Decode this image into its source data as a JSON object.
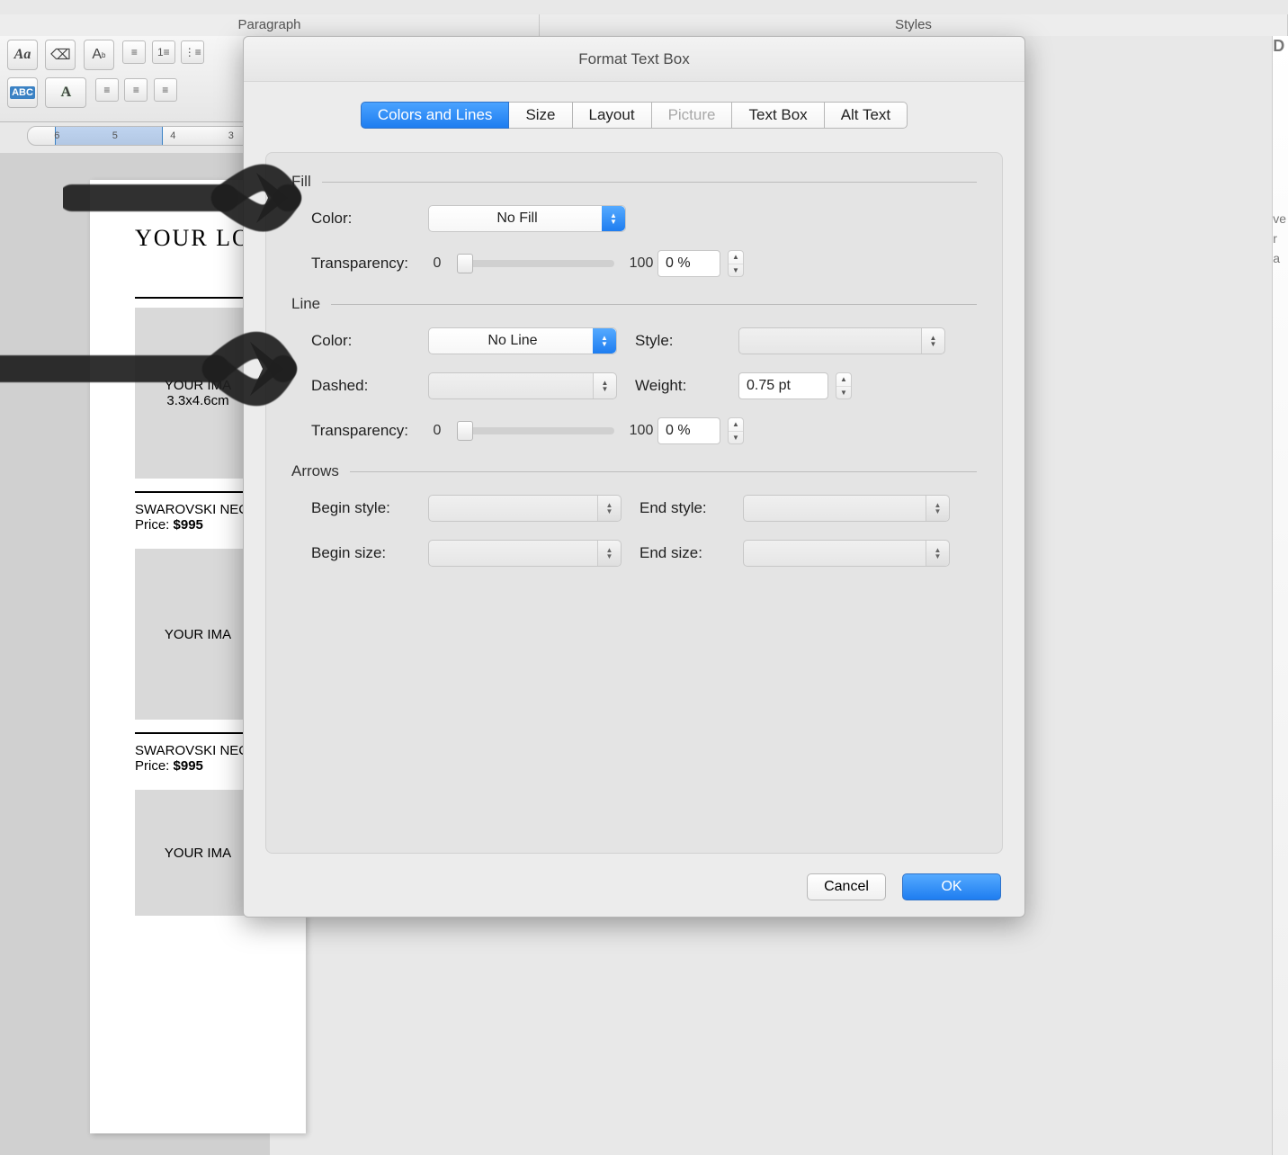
{
  "ribbon": {
    "group_paragraph": "Paragraph",
    "group_styles": "Styles"
  },
  "ruler": {
    "marks": [
      "6",
      "5",
      "4",
      "3"
    ]
  },
  "document": {
    "logo": "YOUR LO",
    "imgph1_l1": "YOUR IMA",
    "imgph1_l2": "3.3x4.6cm",
    "cap_name": "SWAROVSKI NEC",
    "cap_price_lbl": "Price: ",
    "cap_price_val": "$995",
    "imgph2": "YOUR IMA",
    "imgph3": "YOUR IMA"
  },
  "dialog": {
    "title": "Format Text Box",
    "tabs": {
      "colors_lines": "Colors and Lines",
      "size": "Size",
      "layout": "Layout",
      "picture": "Picture",
      "text_box": "Text Box",
      "alt_text": "Alt Text"
    },
    "fill": {
      "header": "Fill",
      "color_lbl": "Color:",
      "color_val": "No Fill",
      "transp_lbl": "Transparency:",
      "min": "0",
      "max": "100",
      "transp_val": "0 %"
    },
    "line": {
      "header": "Line",
      "color_lbl": "Color:",
      "color_val": "No Line",
      "style_lbl": "Style:",
      "dashed_lbl": "Dashed:",
      "weight_lbl": "Weight:",
      "weight_val": "0.75 pt",
      "transp_lbl": "Transparency:",
      "min": "0",
      "max": "100",
      "transp_val": "0 %"
    },
    "arrows": {
      "header": "Arrows",
      "begin_style": "Begin style:",
      "end_style": "End style:",
      "begin_size": "Begin size:",
      "end_size": "End size:"
    },
    "buttons": {
      "cancel": "Cancel",
      "ok": "OK"
    }
  },
  "sidestrip": {
    "l1": "D",
    "l2": "ve",
    "l3": "r",
    "l4": "a"
  }
}
